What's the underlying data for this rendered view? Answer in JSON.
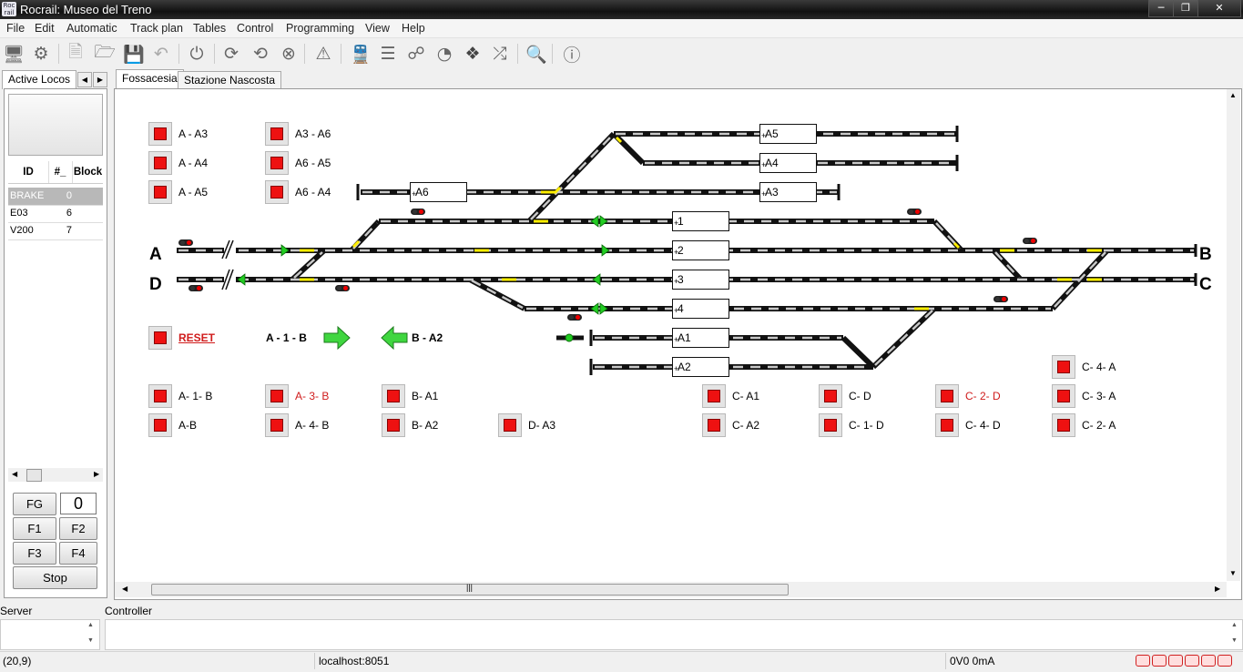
{
  "window": {
    "title": "Rocrail: Museo del Treno",
    "icon_text": "Roc rail",
    "controls": [
      "minimize-icon",
      "restore-icon",
      "close-icon"
    ]
  },
  "menu": [
    "File",
    "Edit",
    "Automatic",
    "Track plan",
    "Tables",
    "Control",
    "Programming",
    "View",
    "Help"
  ],
  "toolbar_icons": [
    "rocrail-server-icon",
    "settings-gears-icon",
    "new-file-icon",
    "open-folder-icon",
    "save-icon",
    "undo-icon",
    "power-icon",
    "reset-cycle-icon",
    "refresh-icon",
    "stop-circle-icon",
    "warning-icon",
    "locomotive-icon",
    "switchboard-icon",
    "turnouts-icon",
    "speedometer-icon",
    "modules-icon",
    "shuffle-icon",
    "zoom-icon",
    "info-icon"
  ],
  "left": {
    "tabs": [
      "Active Locos"
    ],
    "columns": [
      "ID",
      "#_",
      "Block"
    ],
    "rows": [
      {
        "id": "BRAKE",
        "num": "0",
        "block": ""
      },
      {
        "id": "E03",
        "num": "6",
        "block": ""
      },
      {
        "id": "V200",
        "num": "7",
        "block": ""
      }
    ],
    "fg": "FG",
    "speed": "0",
    "f1": "F1",
    "f2": "F2",
    "f3": "F3",
    "f4": "F4",
    "stop": "Stop"
  },
  "tabs": [
    "Fossacesia",
    "Stazione Nascosta"
  ],
  "blocks": [
    "A5",
    "A4",
    "A6",
    "A3",
    "1",
    "2",
    "3",
    "4",
    "A1",
    "A2"
  ],
  "endpoints": {
    "a": "A",
    "d": "D",
    "b": "B",
    "c": "C"
  },
  "routes": {
    "a_a3": "A - A3",
    "a_a4": "A - A4",
    "a_a5": "A - A5",
    "a3_a6": "A3 - A6",
    "a6_a5": "A6 - A5",
    "a6_a4": "A6 - A4",
    "reset": "RESET",
    "a1b": "A - 1 - B",
    "ba2": "B - A2",
    "c4a_top": "C- 4- A",
    "a1b2": "A- 1- B",
    "a3b": "A- 3- B",
    "ba1": "B- A1",
    "ca1": "C- A1",
    "cd": "C- D",
    "c2d": "C- 2- D",
    "c3a": "C- 3- A",
    "ab": "A-B",
    "a4b": "A- 4- B",
    "ba2b": "B- A2",
    "da3": "D- A3",
    "ca2": "C- A2",
    "c1d": "C- 1- D",
    "c4d": "C- 4- D",
    "c2a": "C- 2- A"
  },
  "bottom": {
    "server": "Server",
    "controller": "Controller"
  },
  "status": {
    "coords": "(20,9)",
    "host": "localhost:8051",
    "power": "0V0 0mA"
  },
  "colors": {
    "route_red": "#ee1111",
    "signal_green": "#22cc22",
    "track_yellow": "#ffee00"
  }
}
